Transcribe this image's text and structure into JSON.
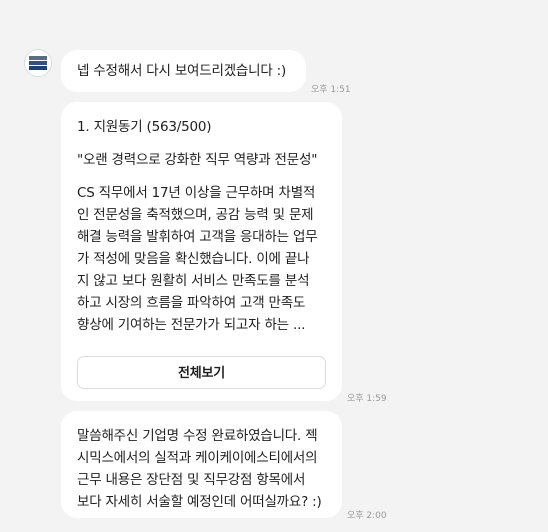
{
  "avatar": {
    "lines": [
      "미래앤",
      "소프트웨어",
      "교육센터"
    ],
    "colors": [
      "#5b6b84",
      "#2f4f8f",
      "#1c3f7a"
    ]
  },
  "messages": [
    {
      "text": "넵 수정해서 다시 보여드리겠습니다 :)",
      "time": "오후 1:51"
    },
    {
      "heading": "1. 지원동기 (563/500)",
      "quote": "\"오랜 경력으로 강화한 직무 역량과 전문성\"",
      "body_lines": [
        " CS 직무에서 17년 이상을 근무하며 차별적",
        "인 전문성을 축적했으며, 공감 능력 및 문제",
        "해결 능력을 발휘하여 고객을 응대하는 업무",
        "가 적성에 맞음을 확신했습니다. 이에 끝나",
        "지 않고 보다 원활히 서비스 만족도를 분석",
        "하고 시장의 흐름을 파악하여 고객 만족도",
        "향상에 기여하는 전문가가 되고자 하는 ..."
      ],
      "button_label": "전체보기",
      "time": "오후 1:59"
    },
    {
      "lines": [
        "말씀해주신 기업명 수정 완료하였습니다. 젝",
        "시믹스에서의 실적과 케이케이에스티에서의",
        "근무 내용은 장단점 및 직무강점 항목에서",
        "보다 자세히 서술할 예정인데 어떠실까요? :)"
      ],
      "time": "오후 2:00"
    }
  ]
}
